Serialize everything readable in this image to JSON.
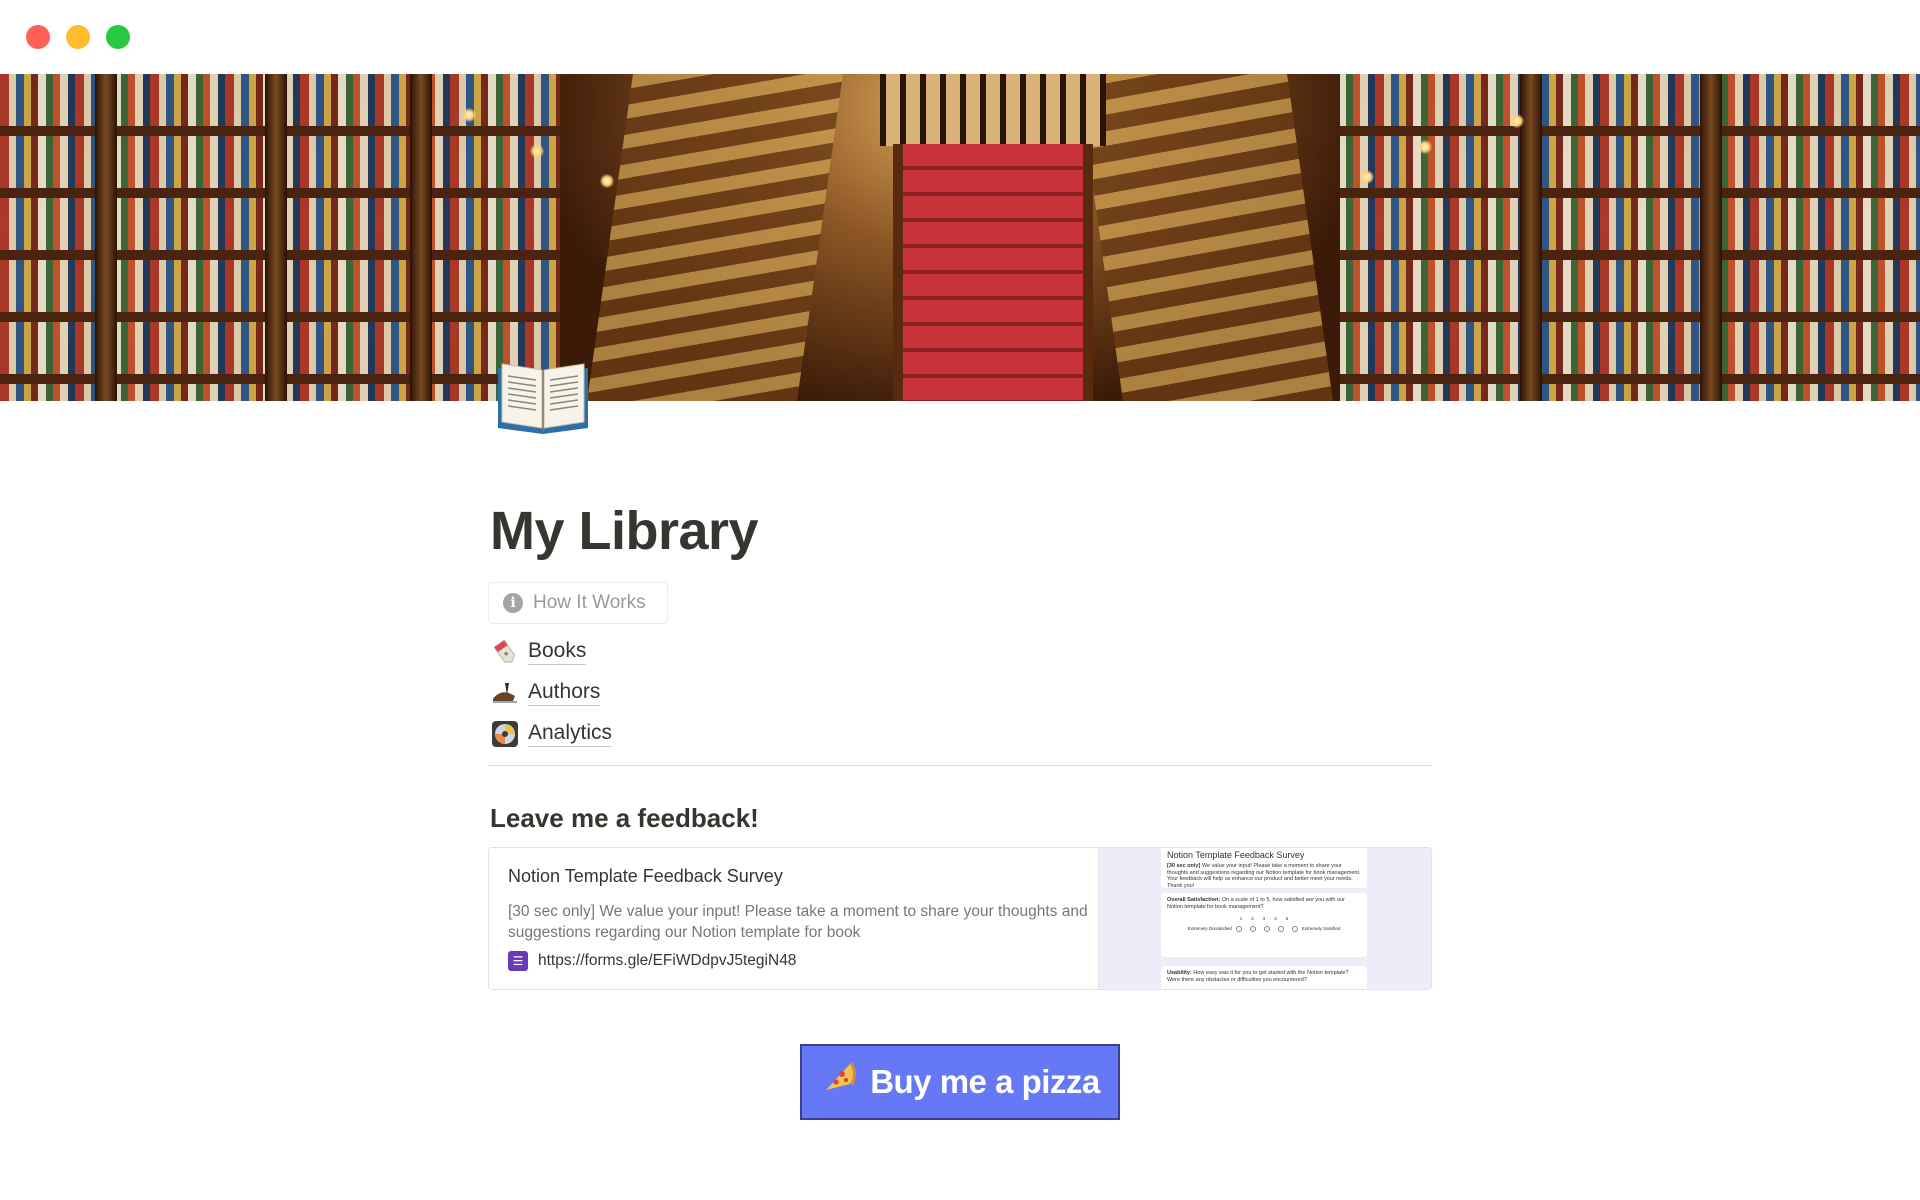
{
  "window": {
    "controls": [
      "close",
      "minimize",
      "zoom"
    ]
  },
  "cover": {
    "icon": "bookshop-cover-image"
  },
  "page": {
    "icon": "open-book-icon",
    "title": "My Library"
  },
  "callout": {
    "label": "How It Works",
    "icon": "info-icon"
  },
  "links": [
    {
      "label": "Books",
      "icon": "bookmark-tag-icon"
    },
    {
      "label": "Authors",
      "icon": "writing-hand-icon"
    },
    {
      "label": "Analytics",
      "icon": "disc-icon"
    }
  ],
  "feedback": {
    "heading": "Leave me a feedback!",
    "bookmark": {
      "title": "Notion Template Feedback Survey",
      "description": "[30 sec only] We value your input! Please take a moment to share your thoughts and suggestions regarding our Notion template for book",
      "url": "https://forms.gle/EFiWDdpvJ5tegiN48",
      "thumbnail": {
        "header": "Notion Template Feedback Survey",
        "intro_bold": "[30 sec only]",
        "intro": "We value your input! Please take a moment to share your thoughts and suggestions regarding our Notion template for book management. Your feedback will help us enhance our product and better meet your needs. Thank you!",
        "q1_bold": "Overall Satisfaction:",
        "q1": "On a scale of 1 to 5, how satisfied are you with our Notion template for book management?",
        "scale": [
          "1",
          "2",
          "3",
          "4",
          "5"
        ],
        "scale_low": "Extremely Dissatisfied",
        "scale_high": "Extremely Satisfied",
        "q2_bold": "Usability:",
        "q2": "How easy was it for you to get started with the Notion template? Were there any obstacles or difficulties you encountered?"
      }
    }
  },
  "cta": {
    "label": "Buy me a pizza",
    "icon": "pizza-icon",
    "color": "#6578f5"
  }
}
